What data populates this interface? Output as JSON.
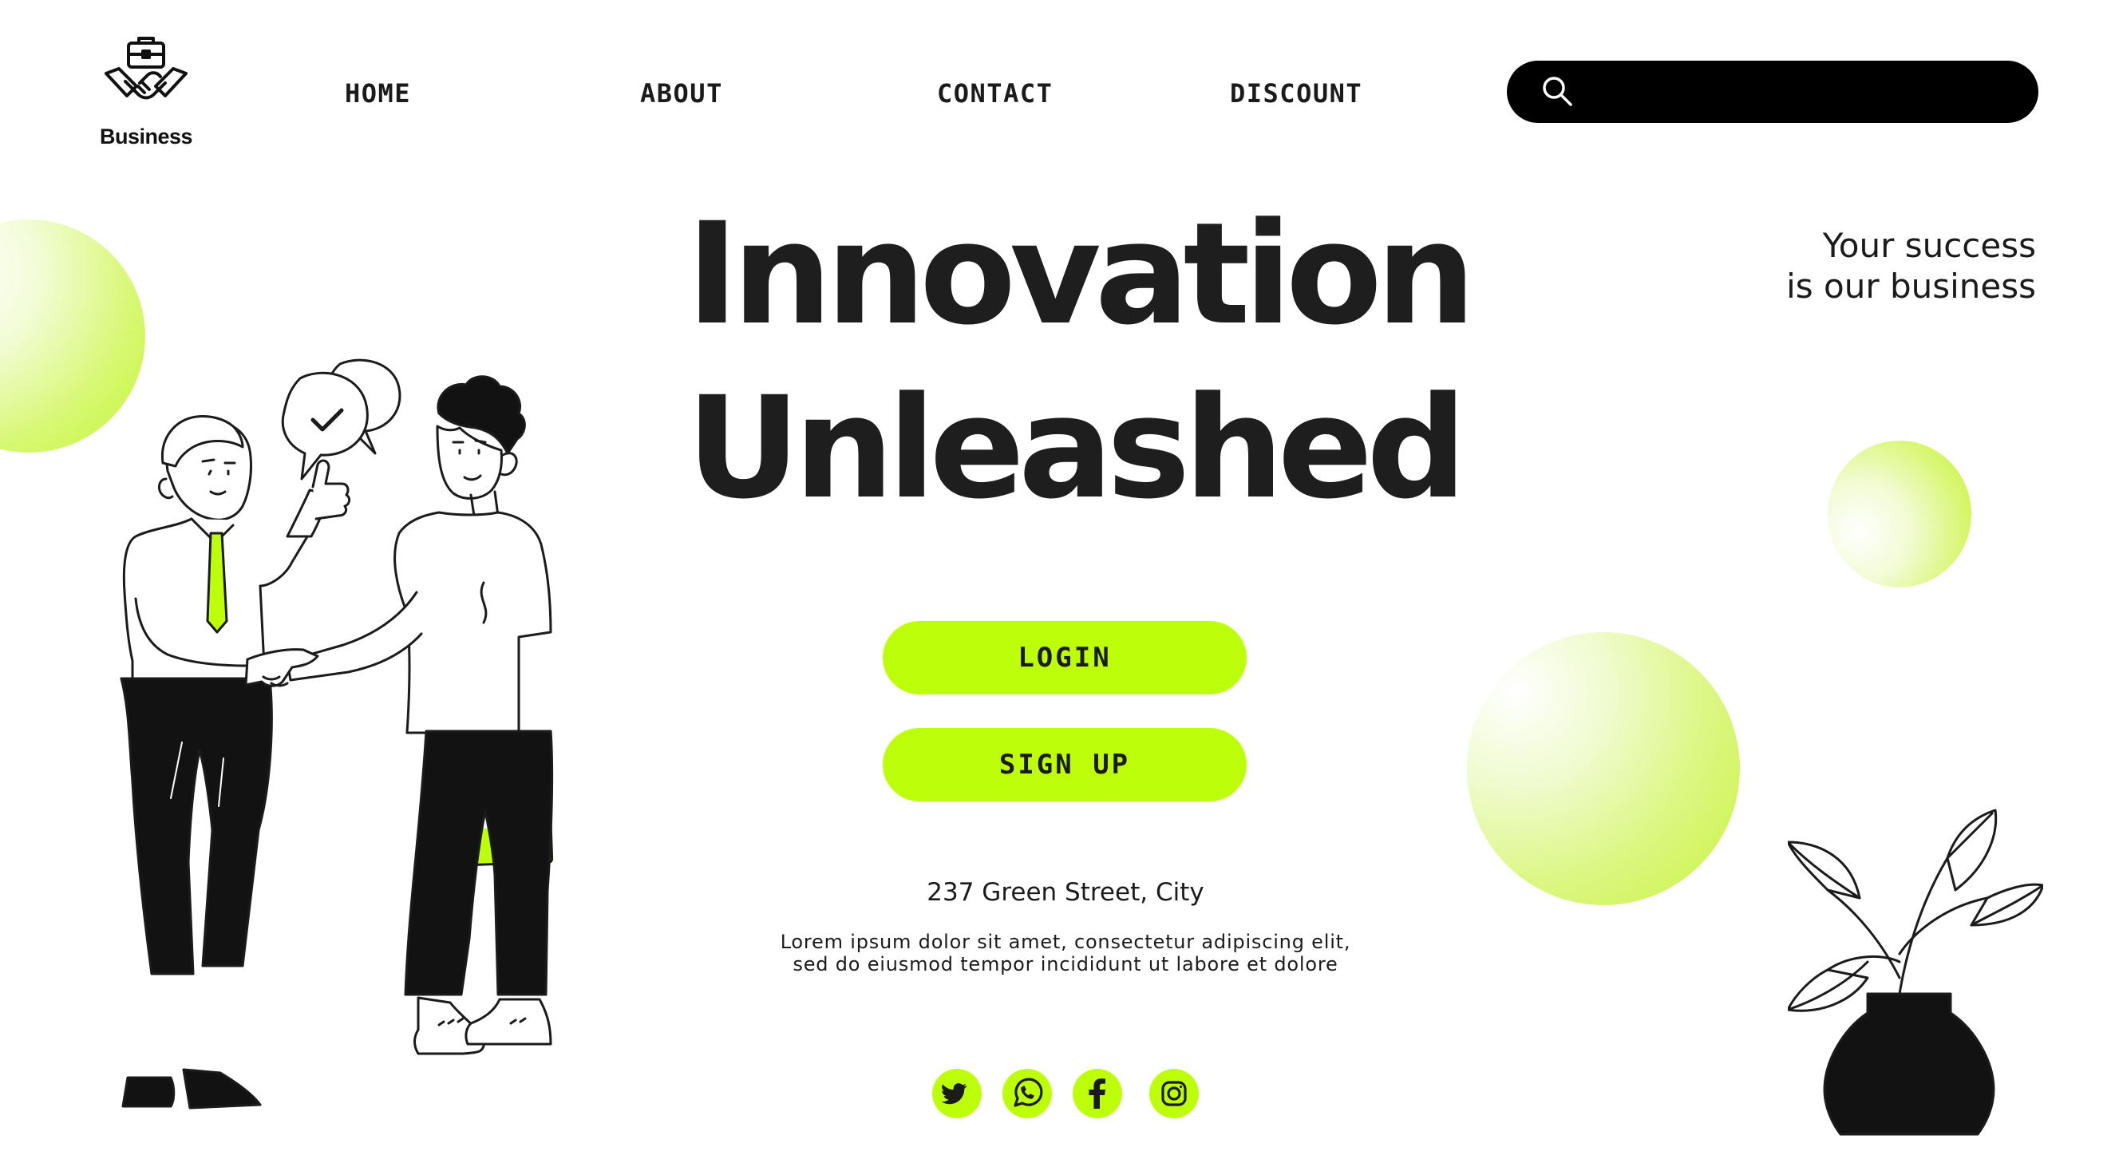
{
  "brand": {
    "name": "Business",
    "icon": "briefcase-handshake-icon"
  },
  "nav": {
    "items": [
      {
        "label": "HOME"
      },
      {
        "label": "ABOUT"
      },
      {
        "label": "CONTACT"
      },
      {
        "label": "DISCOUNT"
      }
    ]
  },
  "search": {
    "placeholder": "",
    "value": "",
    "icon": "search-icon"
  },
  "hero": {
    "headline_line1": "Innovation",
    "headline_line2": "Unleashed",
    "tagline_line1": "Your success",
    "tagline_line2": "is our business"
  },
  "actions": {
    "login_label": "LOGIN",
    "signup_label": "SIGN UP"
  },
  "footer": {
    "address": "237 Green Street, City",
    "description_line1": "Lorem ipsum dolor sit amet, consectetur adipiscing elit,",
    "description_line2": "sed do eiusmod tempor incididunt ut labore et dolore"
  },
  "social": [
    "twitter-icon",
    "whatsapp-icon",
    "facebook-icon",
    "instagram-icon"
  ],
  "colors": {
    "accent": "#bdff0a",
    "text": "#1b1b1b",
    "search_bg": "#000000",
    "background": "#ffffff"
  }
}
